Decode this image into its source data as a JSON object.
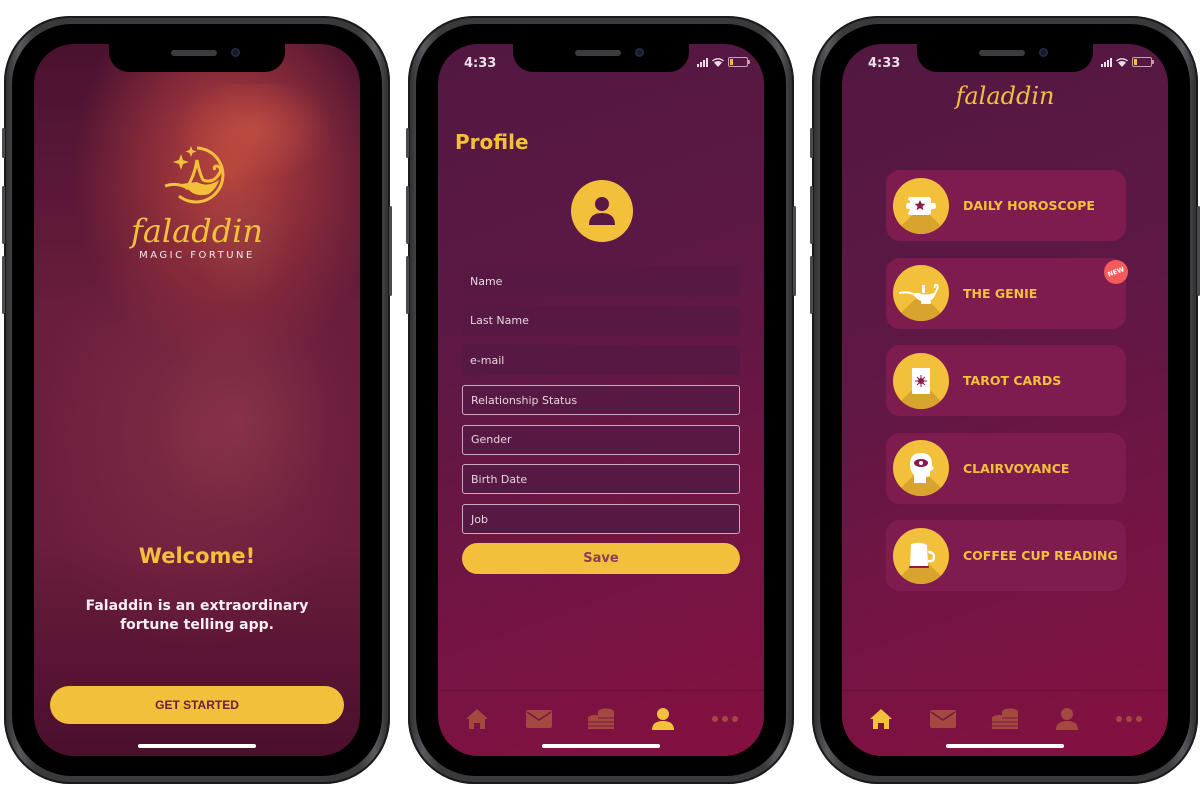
{
  "colors": {
    "accent": "#f3c03b",
    "background_top": "#521841",
    "background_bottom": "#84103f",
    "card": "#7e1c50",
    "badge": "#f55a5a",
    "tab_inactive": "#a4493f"
  },
  "status_bar": {
    "time": "4:33",
    "icons": [
      "signal-icon",
      "wifi-icon",
      "battery-low-icon"
    ]
  },
  "welcome_screen": {
    "brand": "faladdin",
    "tagline": "MAGIC FORTUNE",
    "title": "Welcome!",
    "description": "Faladdin is an extraordinary fortune telling app.",
    "cta_label": "GET STARTED"
  },
  "profile_screen": {
    "title": "Profile",
    "fields": [
      {
        "placeholder": "Name",
        "style": "filled"
      },
      {
        "placeholder": "Last Name",
        "style": "filled"
      },
      {
        "placeholder": "e-mail",
        "style": "filled"
      },
      {
        "placeholder": "Relationship Status",
        "style": "outlined"
      },
      {
        "placeholder": "Gender",
        "style": "outlined"
      },
      {
        "placeholder": "Birth Date",
        "style": "outlined"
      },
      {
        "placeholder": "Job",
        "style": "outlined"
      }
    ],
    "save_label": "Save",
    "active_tab": "profile"
  },
  "home_screen": {
    "brand": "faladdin",
    "menu": [
      {
        "label": "DAILY HOROSCOPE",
        "icon": "scroll-star-icon"
      },
      {
        "label": "THE GENIE",
        "icon": "magic-lamp-icon",
        "badge": "NEW"
      },
      {
        "label": "TAROT CARDS",
        "icon": "tarot-card-icon"
      },
      {
        "label": "CLAIRVOYANCE",
        "icon": "third-eye-head-icon"
      },
      {
        "label": "COFFEE CUP READING",
        "icon": "coffee-cup-icon"
      }
    ],
    "active_tab": "home"
  },
  "tabbar": {
    "tabs": [
      {
        "id": "home",
        "icon": "home-icon"
      },
      {
        "id": "messages",
        "icon": "envelope-icon"
      },
      {
        "id": "coins",
        "icon": "coins-icon"
      },
      {
        "id": "profile",
        "icon": "user-icon"
      },
      {
        "id": "more",
        "icon": "more-dots-icon"
      }
    ]
  }
}
